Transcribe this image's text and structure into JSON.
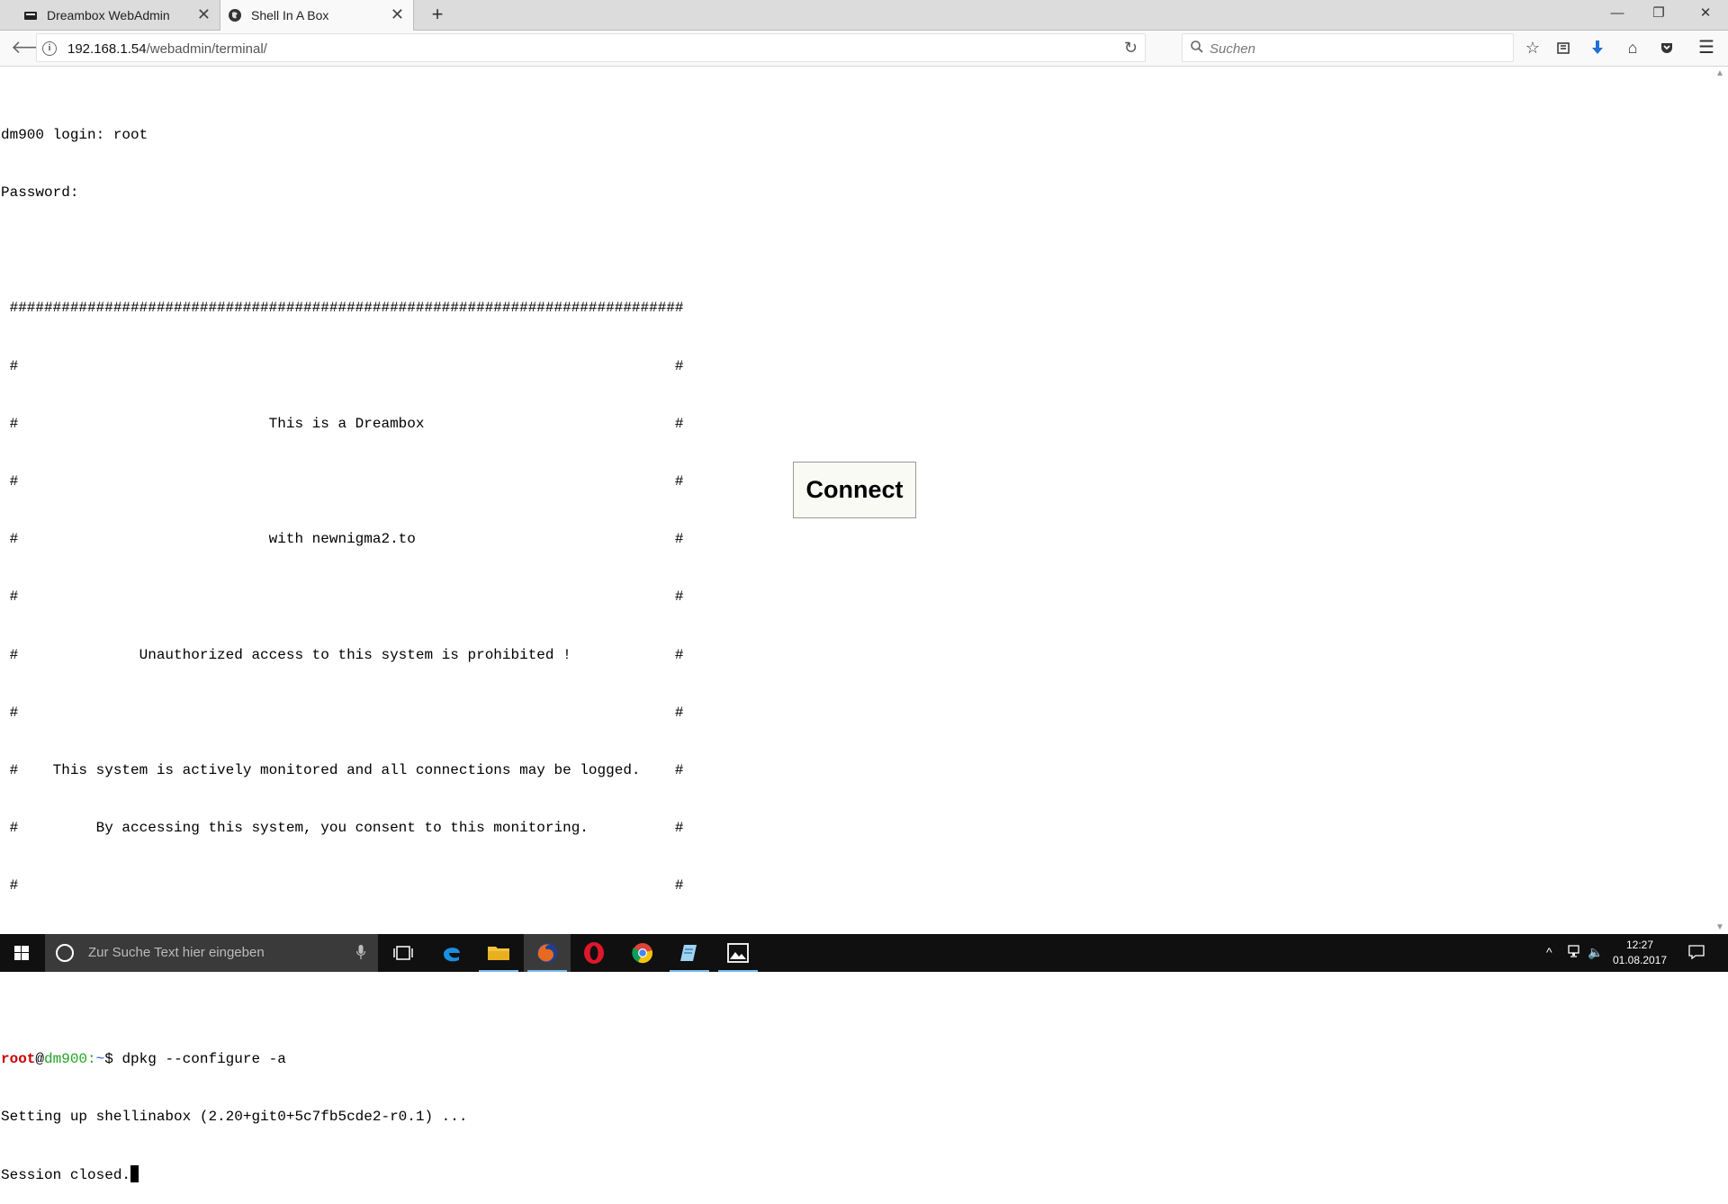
{
  "browser": {
    "tabs": [
      {
        "label": "Dreambox WebAdmin",
        "active": false
      },
      {
        "label": "Shell In A Box",
        "active": true
      }
    ],
    "new_tab_label": "+",
    "url_host": "192.168.1.54",
    "url_path": "/webadmin/terminal/",
    "search_placeholder": "Suchen"
  },
  "terminal": {
    "lines": [
      "dm900 login: root",
      "Password:",
      "",
      " ##############################################################################",
      " #                                                                            #",
      " #                             This is a Dreambox                             #",
      " #                                                                            #",
      " #                             with newnigma2.to                              #",
      " #                                                                            #",
      " #              Unauthorized access to this system is prohibited !            #",
      " #                                                                            #",
      " #    This system is actively monitored and all connections may be logged.    #",
      " #         By accessing this system, you consent to this monitoring.          #",
      " #                                                                            #",
      " ##############################################################################",
      ""
    ],
    "prompt_user": "root",
    "prompt_at": "@",
    "prompt_host": "dm900",
    "prompt_sep": ":",
    "prompt_path": "~",
    "prompt_end": "$ ",
    "command": "dpkg --configure -a",
    "output_line": "Setting up shellinabox (2.20+git0+5c7fb5cde2-r0.1) ...",
    "closed_line": "Session closed."
  },
  "connect_label": "Connect",
  "taskbar": {
    "search_placeholder": "Zur Suche Text hier eingeben",
    "time": "12:27",
    "date": "01.08.2017"
  }
}
